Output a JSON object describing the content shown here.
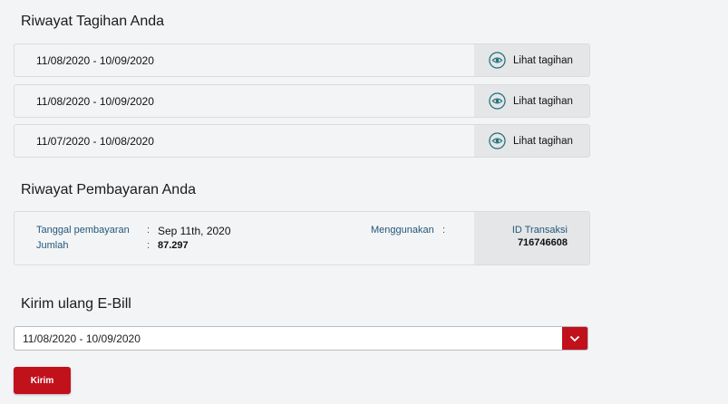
{
  "bill_history": {
    "title": "Riwayat Tagihan Anda",
    "view_label": "Lihat tagihan",
    "rows": [
      {
        "period": "11/08/2020 - 10/09/2020"
      },
      {
        "period": "11/08/2020 - 10/09/2020"
      },
      {
        "period": "11/07/2020 - 10/08/2020"
      }
    ]
  },
  "payment_history": {
    "title": "Riwayat Pembayaran Anda",
    "date_label": "Tanggal pembayaran",
    "date_value": "Sep 11th, 2020",
    "amount_label": "Jumlah",
    "amount_value": "87.297",
    "method_label": "Menggunakan",
    "method_value": "",
    "transaction_id_label": "ID Transaksi",
    "transaction_id_value": "716746608",
    "colon": ":"
  },
  "resend_ebill": {
    "title": "Kirim ulang E-Bill",
    "selected_period": "11/08/2020 - 10/09/2020",
    "submit_label": "Kirim"
  },
  "colors": {
    "accent": "#c1121c",
    "label_blue": "#23587a",
    "page_bg": "#f3f4f6",
    "panel_gray": "#e5e6e8"
  }
}
